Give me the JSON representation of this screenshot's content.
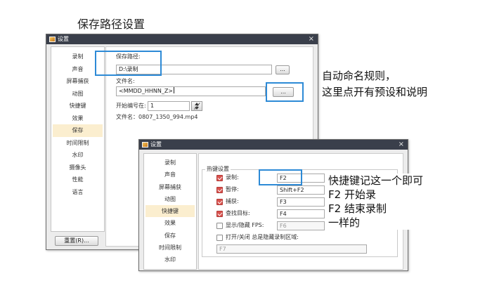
{
  "caption": "保存路径设置",
  "colors": {
    "titlebar": "#3a3f4b",
    "highlight_box": "#2d8ad6",
    "selected_item": "#fbeecf",
    "checkbox_checked": "#d9534f"
  },
  "dialog1": {
    "title": "设置",
    "close": "×",
    "sidebar": [
      {
        "label": "录制"
      },
      {
        "label": "声音"
      },
      {
        "label": "屏幕捕获"
      },
      {
        "label": "动图"
      },
      {
        "label": "快捷键"
      },
      {
        "label": "效果"
      },
      {
        "label": "保存",
        "selected": true
      },
      {
        "label": "时间限制"
      },
      {
        "label": "水印"
      },
      {
        "label": "摄像头"
      },
      {
        "label": "性能"
      },
      {
        "label": "语言"
      }
    ],
    "reset_button": "重置(R)...",
    "save_path": {
      "label": "保存路径:",
      "value": "D:\\录制",
      "button": "..."
    },
    "file_name": {
      "label": "文件名:",
      "value": "<MMDD_HHNN_Z>",
      "button": "..."
    },
    "start_number": {
      "label": "开始编号在:",
      "value": "1"
    },
    "preview": "文件名：0807_1350_994.mp4"
  },
  "annotation1": {
    "line1": "自动命名规则，",
    "line2": "这里点开有预设和说明"
  },
  "dialog2": {
    "title": "设置",
    "close": "×",
    "sidebar": [
      {
        "label": "录制"
      },
      {
        "label": "声音"
      },
      {
        "label": "屏幕捕获"
      },
      {
        "label": "动图"
      },
      {
        "label": "快捷键",
        "selected": true
      },
      {
        "label": "效果"
      },
      {
        "label": "保存"
      },
      {
        "label": "时间限制"
      },
      {
        "label": "水印"
      }
    ],
    "group_title": "热键设置",
    "hotkeys": [
      {
        "label": "录制:",
        "value": "F2",
        "checked": true
      },
      {
        "label": "暂停:",
        "value": "Shift+F2",
        "checked": true
      },
      {
        "label": "捕获:",
        "value": "F3",
        "checked": true
      },
      {
        "label": "查找目标:",
        "value": "F4",
        "checked": true
      },
      {
        "label": "显示/隐藏 FPS:",
        "value": "F6",
        "checked": false
      }
    ],
    "region_toggle": {
      "label": "打开/关闭 总是隐藏录制区域:",
      "value": "F7",
      "checked": false
    }
  },
  "annotation2": {
    "line1": "快捷键记这一个即可",
    "line2": "F2 开始录",
    "line3": "F2 结束录制",
    "line4": "一样的"
  }
}
